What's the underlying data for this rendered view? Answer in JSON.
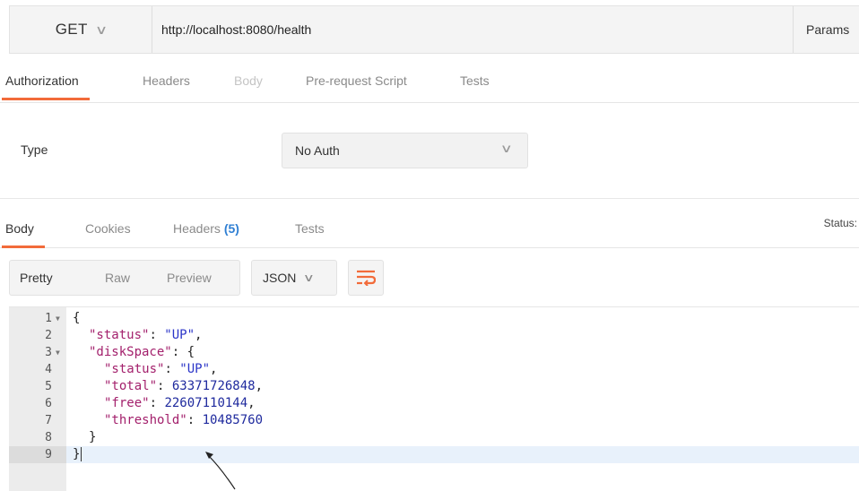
{
  "request": {
    "method": "GET",
    "url": "http://localhost:8080/health",
    "params_label": "Params"
  },
  "request_tabs": {
    "authorization": "Authorization",
    "headers": "Headers",
    "body": "Body",
    "prerequest": "Pre-request Script",
    "tests": "Tests"
  },
  "auth": {
    "type_label": "Type",
    "type_value": "No Auth"
  },
  "response_tabs": {
    "body": "Body",
    "cookies": "Cookies",
    "headers": "Headers",
    "headers_count": "(5)",
    "tests": "Tests",
    "status_label": "Status:"
  },
  "toolbar": {
    "pretty": "Pretty",
    "raw": "Raw",
    "preview": "Preview",
    "format": "JSON"
  },
  "editor": {
    "line_numbers": [
      "1",
      "2",
      "3",
      "4",
      "5",
      "6",
      "7",
      "8",
      "9"
    ],
    "lines": {
      "l1_open": "{",
      "l2_key": "\"status\"",
      "l2_val": "\"UP\"",
      "l3_key": "\"diskSpace\"",
      "l3_open": "{",
      "l4_key": "\"status\"",
      "l4_val": "\"UP\"",
      "l5_key": "\"total\"",
      "l5_val": "63371726848",
      "l6_key": "\"free\"",
      "l6_val": "22607110144",
      "l7_key": "\"threshold\"",
      "l7_val": "10485760",
      "l8_close": "}",
      "l9_close": "}"
    }
  },
  "colors": {
    "accent": "#f26b3a",
    "json_key": "#a3206c",
    "json_value": "#2b35c8",
    "count_badge": "#2f7fd3"
  }
}
